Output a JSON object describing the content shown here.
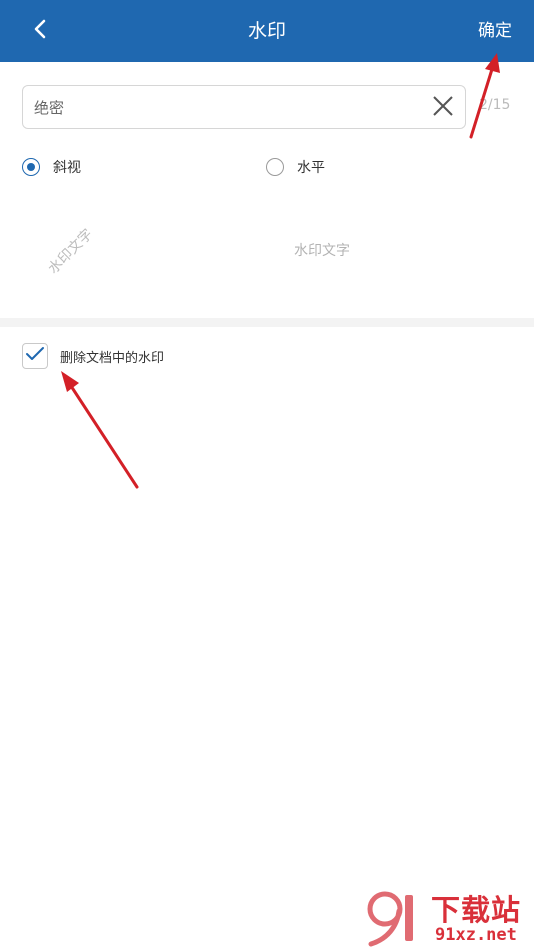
{
  "header": {
    "title": "水印",
    "back_icon": "chevron-left-icon",
    "confirm_label": "确定"
  },
  "watermark_input": {
    "value": "绝密",
    "placeholder": "",
    "clear_icon": "close-icon",
    "char_count": "2/15"
  },
  "style_options": [
    {
      "label": "斜视",
      "checked": true
    },
    {
      "label": "水平",
      "checked": false
    }
  ],
  "preview": {
    "tilted_text": "水印文字",
    "horizontal_text": "水印文字"
  },
  "remove_watermark": {
    "label": "删除文档中的水印",
    "checked": true,
    "check_icon": "checkmark-icon"
  },
  "site_logo": {
    "title": "下载站",
    "url": "91xz.net"
  },
  "colors": {
    "header_bg": "#1f68b0",
    "accent": "#1f68b0",
    "annotation_arrow": "#d32027",
    "logo_red": "#d9303a"
  }
}
